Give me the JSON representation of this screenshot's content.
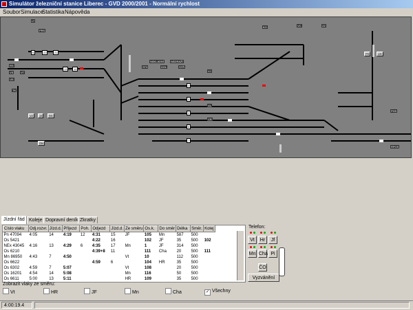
{
  "window": {
    "title": "Simulátor železniční stanice Liberec - GVD 2000/2001 - Normální rychlost"
  },
  "menu": [
    {
      "label": "Soubor"
    },
    {
      "label": "Simulace"
    },
    {
      "label": "Statistika"
    },
    {
      "label": "Nápověda"
    }
  ],
  "panel": {
    "labels": [
      "LT",
      "PRS",
      "RS",
      "VS",
      "VT",
      "US",
      "TK",
      "ST3",
      "DOL",
      "STŘ",
      "NÁKLADNÍ",
      "NÁDRAŽÍ",
      "VJ",
      "VL",
      "CR",
      "KO",
      "VC",
      "ZZ",
      "PHS",
      "RPOS"
    ],
    "blocks": [
      "6",
      "22",
      "21",
      "13",
      "14",
      "1",
      "3",
      "2",
      "5",
      "7"
    ],
    "buttons": [
      "VZ",
      "JZ",
      "RS",
      "ON",
      "PS",
      "US"
    ]
  },
  "tabs": [
    {
      "label": "Jízdní řád",
      "active": true
    },
    {
      "label": "Koleje",
      "active": false
    },
    {
      "label": "Dopravní deník",
      "active": false
    },
    {
      "label": "Zkratky",
      "active": false
    }
  ],
  "table": {
    "headers": [
      "Číslo vlaku",
      "Odj.rozvr.",
      "Jízd.d.",
      "Příjezd",
      "Poh.",
      "Odjezd",
      "Jízd.d.",
      "Ze směru",
      "Os.k.",
      "Do směr",
      "Délka",
      "Směr.",
      "Kolej"
    ],
    "rows": [
      [
        "Pn 47094",
        "4:05",
        "14",
        "4:19",
        "12",
        "4:31",
        "15",
        "JF",
        "105",
        "Mn",
        "587",
        "500",
        ""
      ],
      [
        "Os 5421",
        "",
        "",
        "",
        "",
        "4:22",
        "16",
        "",
        "102",
        "JF",
        "35",
        "500",
        "102"
      ],
      [
        "NEx 43045",
        "4:16",
        "13",
        "4:29",
        "6",
        "4:35",
        "17",
        "Mn",
        "1",
        "JF",
        "314",
        "500",
        ""
      ],
      [
        "Os 6210",
        "",
        "",
        "",
        "",
        "4:39+8",
        "11",
        "",
        "111",
        "Cha",
        "20",
        "500",
        "111"
      ],
      [
        "Mn 86950",
        "4:43",
        "7",
        "4:50",
        "",
        "",
        "",
        "Vt",
        "10",
        "",
        "112",
        "500",
        ""
      ],
      [
        "Os 6622",
        "",
        "",
        "",
        "",
        "4:59",
        "6",
        "",
        "104",
        "HR",
        "35",
        "500",
        ""
      ],
      [
        "Os 6302",
        "4:59",
        "7",
        "5:07",
        "",
        "",
        "",
        "Vt",
        "108",
        "",
        "20",
        "500",
        ""
      ],
      [
        "Os 16201",
        "4:54",
        "14",
        "5:08",
        "",
        "",
        "",
        "Mn",
        "116",
        "",
        "50",
        "500",
        ""
      ],
      [
        "Os 6611",
        "5:00",
        "13",
        "5:11",
        "",
        "",
        "",
        "HR",
        "109",
        "",
        "35",
        "500",
        ""
      ]
    ]
  },
  "filter": {
    "label": "Zobrazit vlaky ze směru:",
    "options": [
      {
        "label": "Vt",
        "checked": false
      },
      {
        "label": "HR",
        "checked": false
      },
      {
        "label": "JF",
        "checked": false
      },
      {
        "label": "Mn",
        "checked": false
      },
      {
        "label": "Cha",
        "checked": false
      },
      {
        "label": "Všechny",
        "checked": true
      }
    ]
  },
  "phone": {
    "title": "Telefon:",
    "buttons": [
      "Vt",
      "Hr",
      "Jf",
      "Mn",
      "Cha",
      "Pi",
      "ČO"
    ],
    "call_label": "Vyzvánění"
  },
  "status": {
    "time": "4:00:19.4"
  }
}
